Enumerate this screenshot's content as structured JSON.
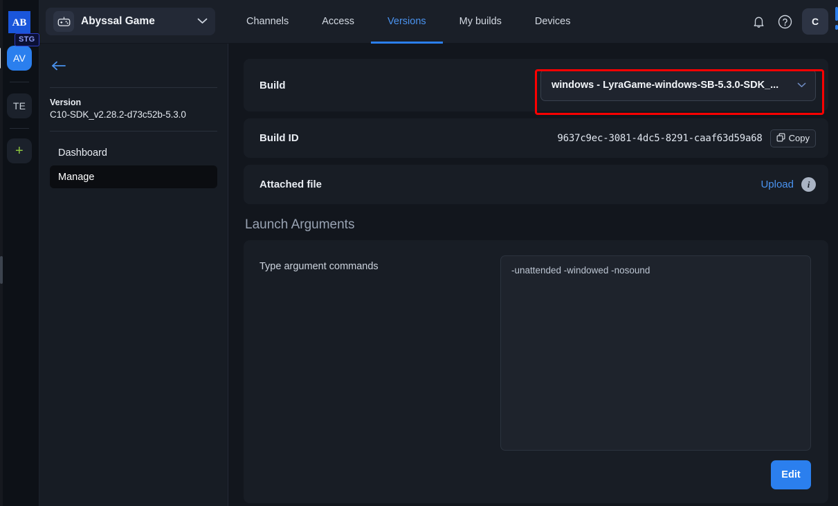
{
  "rail": {
    "logo_name": "logo-ab",
    "env_badge": "STG",
    "tiles": [
      {
        "label": "AV",
        "active": true
      },
      {
        "label": "TE",
        "active": false
      }
    ],
    "add_label": "+"
  },
  "topbar": {
    "project": {
      "icon": "gamepad-icon",
      "name": "Abyssal Game",
      "chevron": "chevron-down-icon"
    },
    "tabs": [
      {
        "label": "Channels",
        "active": false
      },
      {
        "label": "Access",
        "active": false
      },
      {
        "label": "Versions",
        "active": true
      },
      {
        "label": "My builds",
        "active": false
      },
      {
        "label": "Devices",
        "active": false
      }
    ],
    "notifications_icon": "bell-icon",
    "help_icon": "help-circle-icon",
    "avatar_label": "C"
  },
  "sidebar": {
    "back_icon": "arrow-left-icon",
    "version_label": "Version",
    "version_value": "C10-SDK_v2.28.2-d73c52b-5.3.0",
    "items": [
      {
        "label": "Dashboard",
        "active": false
      },
      {
        "label": "Manage",
        "active": true
      }
    ]
  },
  "content": {
    "build": {
      "label": "Build",
      "selected": "windows - LyraGame-windows-SB-5.3.0-SDK_...",
      "chevron": "chevron-down-icon",
      "highlight_color": "#ff0000"
    },
    "build_id": {
      "label": "Build ID",
      "value": "9637c9ec-3081-4dc5-8291-caaf63d59a68",
      "copy_label": "Copy",
      "copy_icon": "copy-icon"
    },
    "attached_file": {
      "label": "Attached file",
      "upload_label": "Upload",
      "info_icon": "info-icon",
      "info_glyph": "i"
    },
    "launch_arguments": {
      "title": "Launch Arguments",
      "field_label": "Type argument commands",
      "value": "-unattended -windowed -nosound",
      "placeholder": "Type argument commands",
      "edit_label": "Edit"
    }
  },
  "colors": {
    "accent": "#2b7fee",
    "link": "#4a93f0",
    "highlight": "#ff0000",
    "app_bg": "#12161d",
    "card_bg": "#181d25"
  }
}
